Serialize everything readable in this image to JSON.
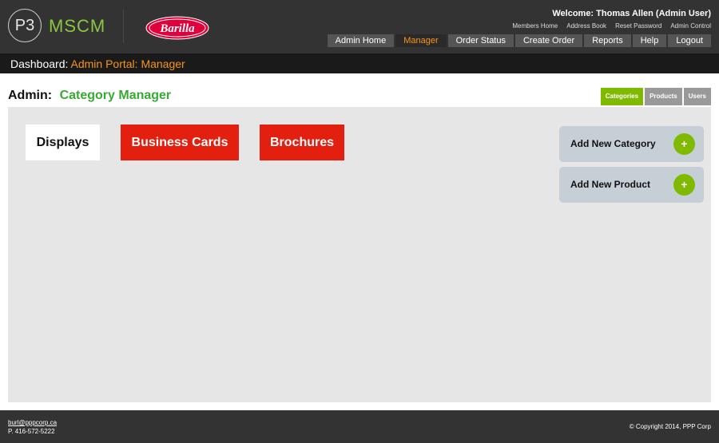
{
  "brand": {
    "p3": "P3",
    "app_name": "MSCM",
    "logo_text": "Barilla"
  },
  "header": {
    "welcome": "Welcome: Thomas Allen (Admin User)",
    "top_links": [
      "Members Home",
      "Address Book",
      "Reset Password",
      "Admin Control"
    ],
    "nav": [
      "Admin Home",
      "Manager",
      "Order Status",
      "Create Order",
      "Reports",
      "Help",
      "Logout"
    ],
    "active_nav": "Manager"
  },
  "dashboard": {
    "label": "Dashboard:",
    "value": "Admin Portal: Manager"
  },
  "admin": {
    "label": "Admin:",
    "title": "Category Manager"
  },
  "subtabs": [
    "Categories",
    "Products",
    "Users"
  ],
  "active_subtab": "Categories",
  "categories": [
    "Displays",
    "Business Cards",
    "Brochures"
  ],
  "actions": {
    "add_category": "Add New Category",
    "add_product": "Add New Product",
    "plus": "+"
  },
  "footer": {
    "email": "burl@pppcorp.ca",
    "phone": "P. 416-572-5222",
    "copyright": "© Copyright 2014, PPP Corp"
  },
  "colors": {
    "accent_green": "#7fba00",
    "accent_orange": "#f7941d",
    "category_red": "#e3200f",
    "title_green": "#39a935"
  }
}
